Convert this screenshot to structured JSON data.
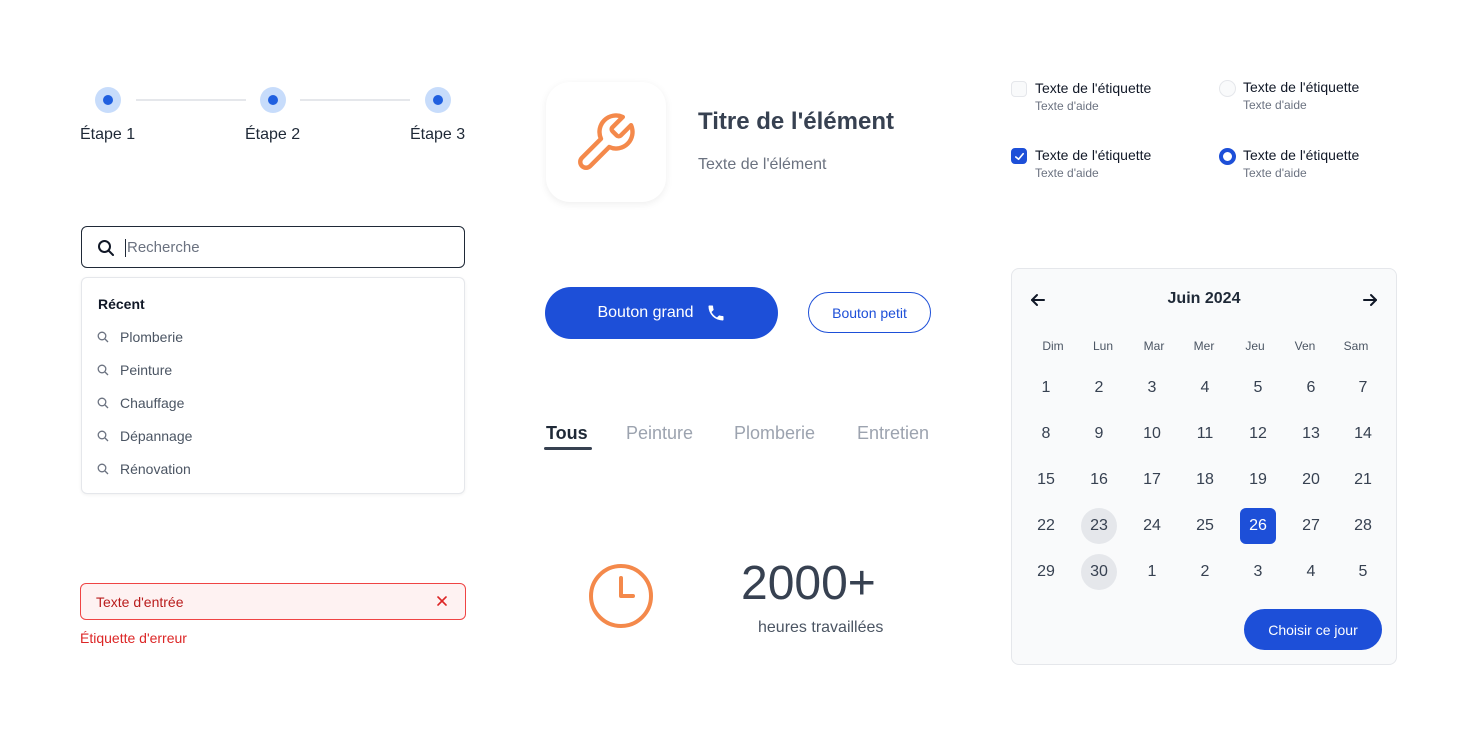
{
  "stepper": {
    "steps": [
      {
        "label": "Étape 1"
      },
      {
        "label": "Étape 2"
      },
      {
        "label": "Étape 3"
      }
    ]
  },
  "search": {
    "placeholder": "Recherche",
    "value": "",
    "recent_title": "Récent",
    "recent_items": [
      "Plomberie",
      "Peinture",
      "Chauffage",
      "Dépannage",
      "Rénovation"
    ]
  },
  "error_field": {
    "value": "Texte d'entrée",
    "error_label": "Étiquette d'erreur"
  },
  "item_card": {
    "icon": "wrench-icon",
    "title": "Titre de l'élément",
    "text": "Texte de l'élément"
  },
  "buttons": {
    "large_label": "Bouton grand",
    "large_icon": "phone-icon",
    "small_label": "Bouton petit"
  },
  "tabs": [
    {
      "label": "Tous",
      "active": true
    },
    {
      "label": "Peinture",
      "active": false
    },
    {
      "label": "Plomberie",
      "active": false
    },
    {
      "label": "Entretien",
      "active": false
    }
  ],
  "stat": {
    "icon": "clock-icon",
    "value": "2000+",
    "label": "heures travaillées"
  },
  "options": [
    {
      "type": "checkbox",
      "checked": false,
      "label": "Texte de l'étiquette",
      "helper": "Texte d'aide"
    },
    {
      "type": "radio",
      "checked": false,
      "label": "Texte de l'étiquette",
      "helper": "Texte d'aide"
    },
    {
      "type": "checkbox",
      "checked": true,
      "label": "Texte de l'étiquette",
      "helper": "Texte d'aide"
    },
    {
      "type": "radio",
      "checked": true,
      "label": "Texte de l'étiquette",
      "helper": "Texte d'aide"
    }
  ],
  "calendar": {
    "month": "Juin 2024",
    "weekdays": [
      "Dim",
      "Lun",
      "Mar",
      "Mer",
      "Jeu",
      "Ven",
      "Sam"
    ],
    "weeks": [
      [
        "1",
        "2",
        "3",
        "4",
        "5",
        "6",
        "7"
      ],
      [
        "8",
        "9",
        "10",
        "11",
        "12",
        "13",
        "14"
      ],
      [
        "15",
        "16",
        "17",
        "18",
        "19",
        "20",
        "21"
      ],
      [
        "22",
        "23",
        "24",
        "25",
        "26",
        "27",
        "28"
      ],
      [
        "29",
        "30",
        "1",
        "2",
        "3",
        "4",
        "5"
      ]
    ],
    "highlighted": [
      "23",
      "30"
    ],
    "selected": "26",
    "choose_label": "Choisir ce jour"
  },
  "colors": {
    "primary": "#1d4fd8",
    "accent_orange": "#f4894b",
    "error": "#dc2626",
    "step_active": "#1f5fe0"
  }
}
